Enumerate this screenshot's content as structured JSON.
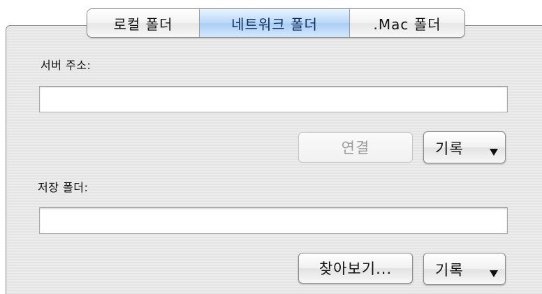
{
  "tabs": {
    "local": "로컬 폴더",
    "network": "네트워크 폴더",
    "mac": ".Mac 폴더",
    "selected": "네트워크 폴더"
  },
  "server": {
    "label": "서버 주소:",
    "value": "",
    "connect_label": "연결",
    "history_label": "기록"
  },
  "save": {
    "label": "저장 폴더:",
    "value": "",
    "browse_label": "찾아보기...",
    "history_label": "기록"
  },
  "colors": {
    "active_tab": "#bad8f7",
    "panel_bg": "#e8e8e8"
  },
  "icons": {
    "popup_arrow": "triangle-down-icon"
  }
}
